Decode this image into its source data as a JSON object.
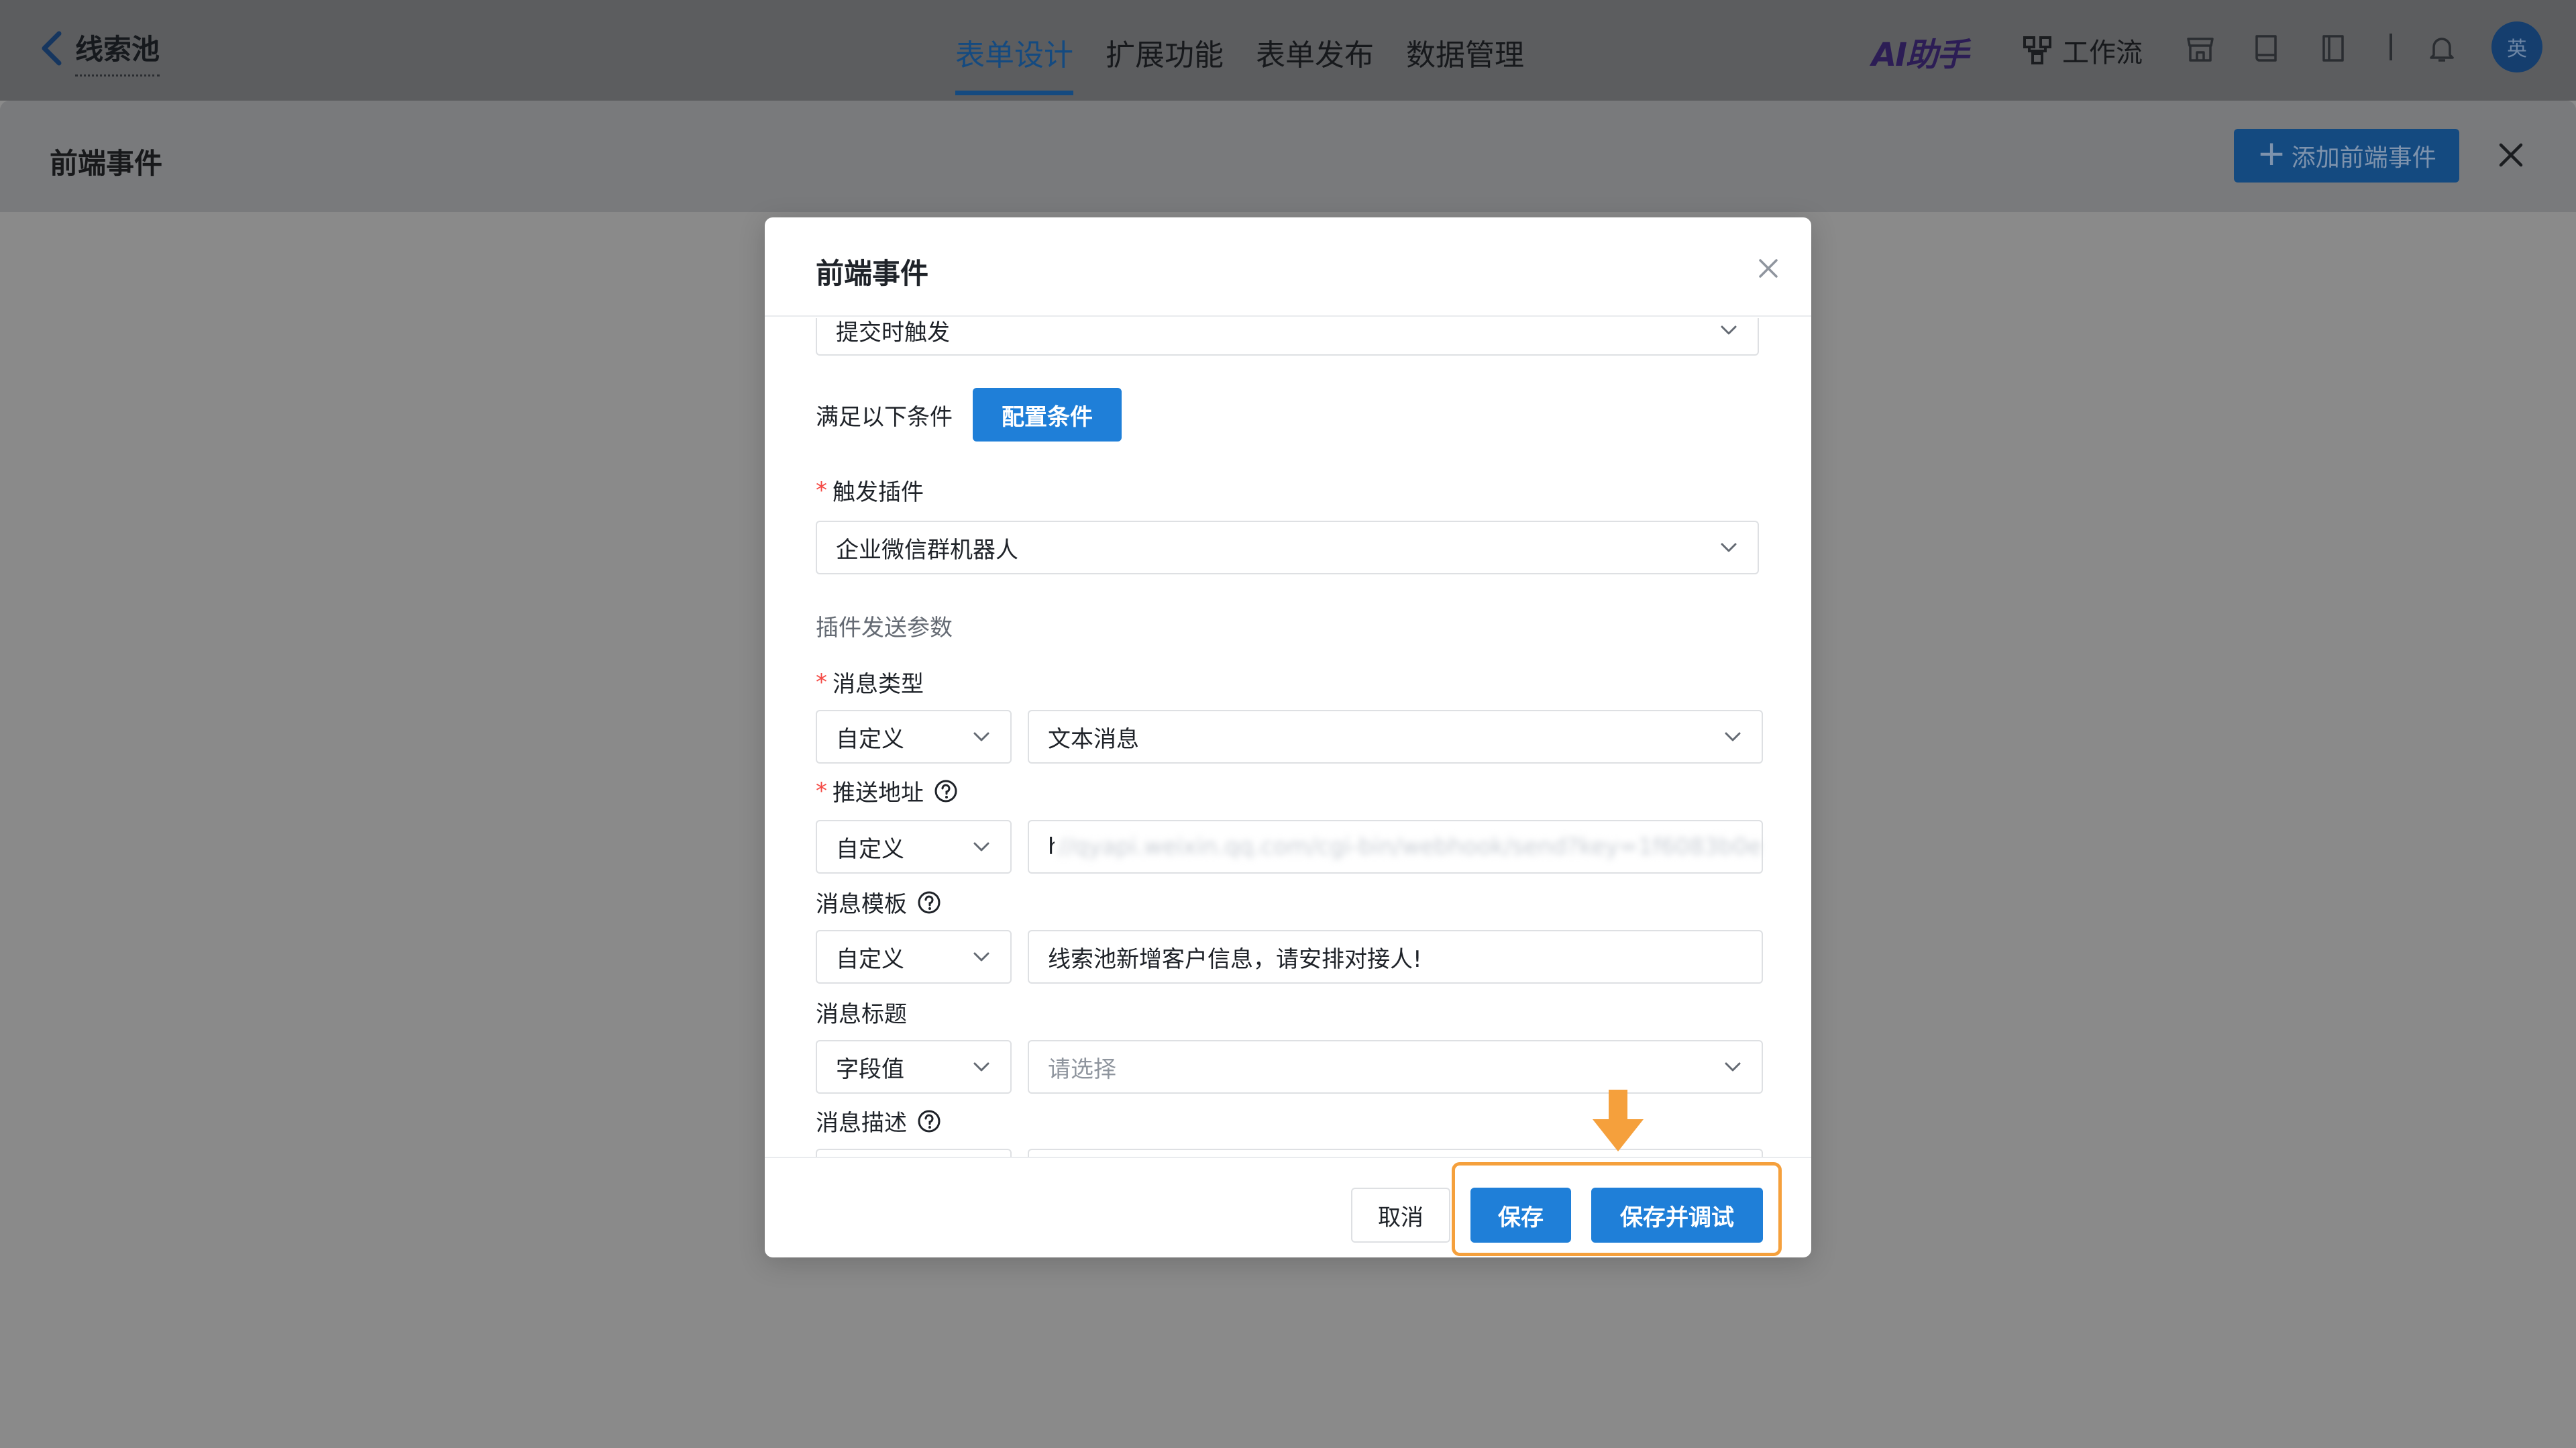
{
  "header": {
    "app_title": "线索池",
    "tabs": [
      {
        "label": "表单设计",
        "active": true
      },
      {
        "label": "扩展功能",
        "active": false
      },
      {
        "label": "表单发布",
        "active": false
      },
      {
        "label": "数据管理",
        "active": false
      }
    ],
    "ai_assistant": "AI助手",
    "workflow": "工作流",
    "icons": [
      "store-icon",
      "book-icon",
      "notebook-icon",
      "bell-icon"
    ],
    "avatar_text": "英"
  },
  "drawer": {
    "title": "前端事件",
    "add_button": "添加前端事件"
  },
  "modal": {
    "title": "前端事件",
    "trigger_value": "提交时触发",
    "condition_label": "满足以下条件",
    "condition_button": "配置条件",
    "plugin_label": "触发插件",
    "plugin_value": "企业微信群机器人",
    "params_label": "插件发送参数",
    "fields": [
      {
        "label": "消息类型",
        "required": true,
        "help": false,
        "source": "自定义",
        "value": "文本消息",
        "kind": "select"
      },
      {
        "label": "推送地址",
        "required": true,
        "help": true,
        "source": "自定义",
        "value": "https:",
        "value_blurred": "//qyapi.weixin.qq.com/cgi-bin/webhook/send?key=1f6083b0e",
        "kind": "input"
      },
      {
        "label": "消息模板",
        "required": false,
        "help": true,
        "source": "自定义",
        "value": "线索池新增客户信息，请安排对接人!",
        "kind": "input"
      },
      {
        "label": "消息标题",
        "required": false,
        "help": false,
        "source": "字段值",
        "placeholder": "请选择",
        "kind": "select"
      },
      {
        "label": "消息描述",
        "required": false,
        "help": true,
        "kind": "select"
      }
    ],
    "footer": {
      "cancel": "取消",
      "save": "保存",
      "save_debug": "保存并调试"
    }
  },
  "colors": {
    "primary": "#1f7fd8",
    "required": "#f54a45",
    "annotation": "#f5a03c"
  }
}
